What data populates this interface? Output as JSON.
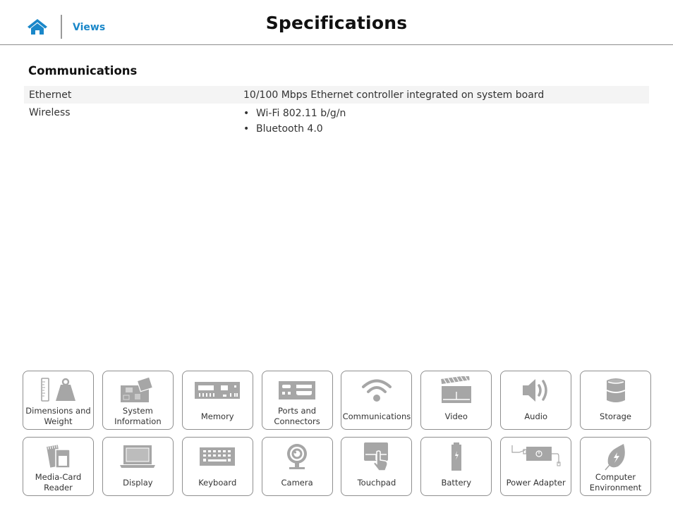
{
  "header": {
    "home_label": "Home",
    "views_label": "Views",
    "title": "Specifications"
  },
  "section": {
    "title": "Communications",
    "rows": [
      {
        "label": "Ethernet",
        "value": "10/100 Mbps Ethernet controller integrated on system board"
      },
      {
        "label": "Wireless",
        "values": [
          "Wi-Fi 802.11 b/g/n",
          "Bluetooth 4.0"
        ]
      }
    ]
  },
  "tiles": [
    {
      "label": "Dimensions and\nWeight",
      "icon": "dimensions-weight-icon"
    },
    {
      "label": "System\nInformation",
      "icon": "system-board-icon"
    },
    {
      "label": "Memory",
      "icon": "memory-module-icon"
    },
    {
      "label": "Ports and\nConnectors",
      "icon": "ports-icon"
    },
    {
      "label": "Communications",
      "icon": "wifi-icon"
    },
    {
      "label": "Video",
      "icon": "clapperboard-icon"
    },
    {
      "label": "Audio",
      "icon": "speaker-icon"
    },
    {
      "label": "Storage",
      "icon": "storage-cylinder-icon"
    },
    {
      "label": "Media-Card\nReader",
      "icon": "media-card-icon"
    },
    {
      "label": "Display",
      "icon": "laptop-display-icon"
    },
    {
      "label": "Keyboard",
      "icon": "keyboard-icon"
    },
    {
      "label": "Camera",
      "icon": "webcam-icon"
    },
    {
      "label": "Touchpad",
      "icon": "touchpad-icon"
    },
    {
      "label": "Battery",
      "icon": "battery-icon"
    },
    {
      "label": "Power Adapter",
      "icon": "power-adapter-icon"
    },
    {
      "label": "Computer\nEnvironment",
      "icon": "leaf-icon"
    }
  ],
  "colors": {
    "accent": "#1a87c9",
    "icon_gray": "#a6a6a6",
    "row_shade": "#f4f4f4",
    "tile_border": "#8f8f8f"
  }
}
